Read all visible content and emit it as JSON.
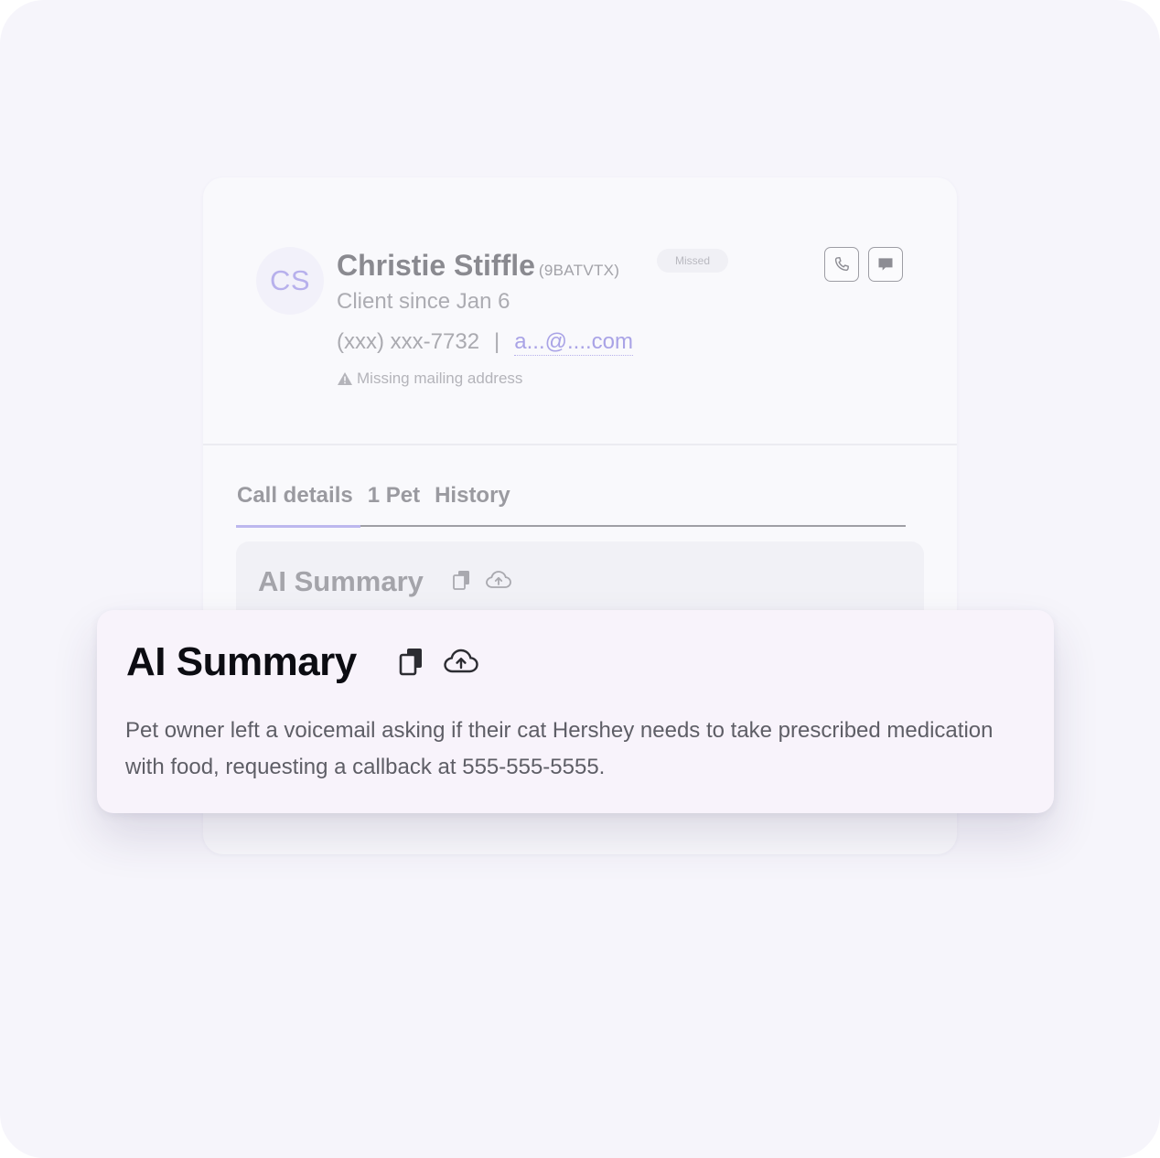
{
  "client": {
    "initials": "CS",
    "name": "Christie Stiffle",
    "code": "(9BATVTX)",
    "status": "Missed",
    "since": "Client since Jan 6",
    "phone": "(xxx) xxx-7732",
    "separator": "|",
    "email": "a...@....com",
    "warning": "Missing mailing address"
  },
  "tabs": [
    {
      "label": "Call details",
      "active": true
    },
    {
      "label": "1 Pet",
      "active": false
    },
    {
      "label": "History",
      "active": false
    }
  ],
  "section": {
    "title": "AI Summary"
  },
  "summary": {
    "title": "AI Summary",
    "text": "Pet owner left a voicemail asking if their cat Hershey needs to take prescribed medication with food, requesting a callback at 555-555-5555."
  },
  "icons": {
    "call": "phone-icon",
    "message": "message-icon",
    "copy": "copy-icon",
    "upload": "cloud-upload-icon",
    "warning": "warning-icon"
  },
  "colors": {
    "accent": "#b7b0ec",
    "panel": "#f8f3fb",
    "background": "#f6f5fb"
  }
}
